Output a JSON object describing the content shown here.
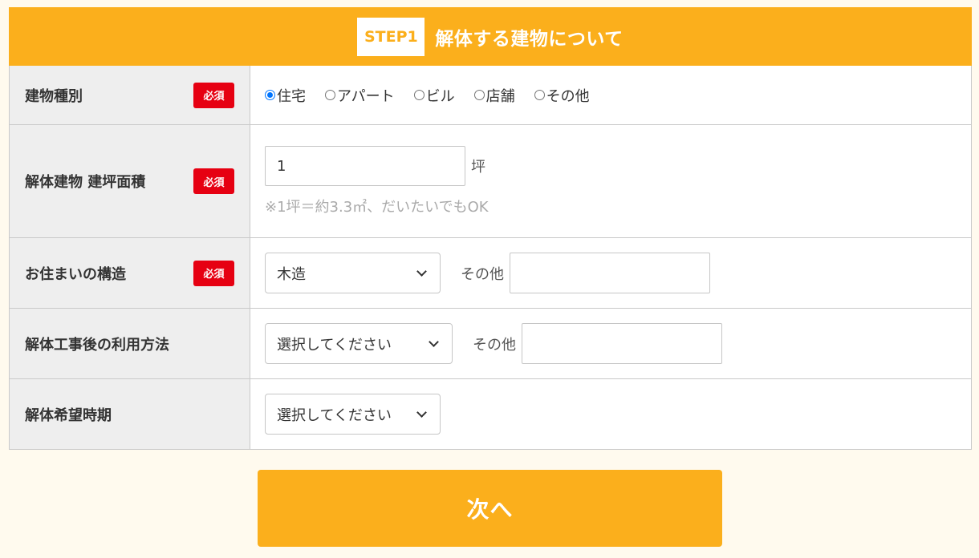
{
  "header": {
    "step_badge": "STEP1",
    "title": "解体する建物について"
  },
  "required_label": "必須",
  "rows": {
    "building_type": {
      "label": "建物種別",
      "options": [
        "住宅",
        "アパート",
        "ビル",
        "店舗",
        "その他"
      ],
      "selected": "住宅"
    },
    "floor_area": {
      "label": "解体建物 建坪面積",
      "value": "1",
      "unit": "坪",
      "note": "※1坪＝約3.3㎡、だいたいでもOK"
    },
    "structure": {
      "label": "お住まいの構造",
      "selected": "木造",
      "other_label": "その他",
      "other_value": ""
    },
    "usage_after": {
      "label": "解体工事後の利用方法",
      "selected": "選択してください",
      "other_label": "その他",
      "other_value": ""
    },
    "timing": {
      "label": "解体希望時期",
      "selected": "選択してください"
    }
  },
  "next_button": "次へ",
  "colors": {
    "accent": "#fbaf1c",
    "required": "#e60012",
    "background": "#fffaee",
    "label_bg": "#eeeeee"
  }
}
